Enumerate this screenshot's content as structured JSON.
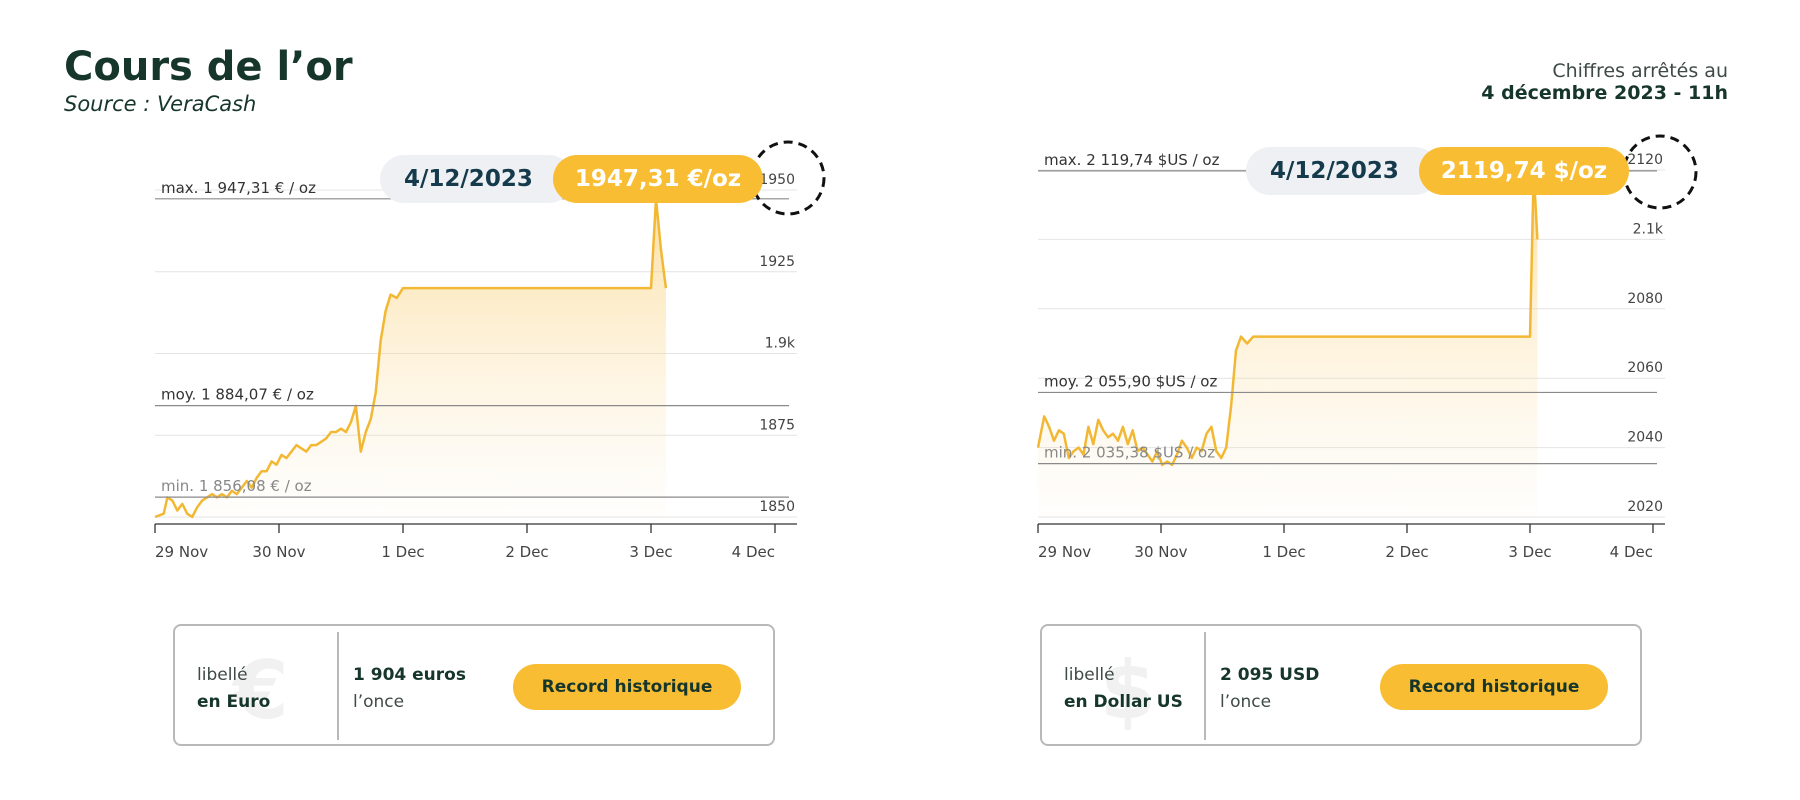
{
  "header": {
    "title": "Cours de l’or",
    "source": "Source : VeraCash",
    "asof_label": "Chiffres arrêtés au",
    "asof_date": "4 décembre 2023 - 11h"
  },
  "colors": {
    "gold": "#f8bd33",
    "line": "#f2b834",
    "dark": "#17362b",
    "navy": "#153a4c",
    "grey": "#b9b9b9"
  },
  "panels": [
    {
      "pill_date": "4/12/2023",
      "pill_value": "1947,31 €/oz",
      "card": {
        "currency_line1": "libellé",
        "currency_line2": "en Euro",
        "symbol": "€",
        "value_line1": "1 904 euros",
        "value_line2": "l’once",
        "button": "Record historique"
      }
    },
    {
      "pill_date": "4/12/2023",
      "pill_value": "2119,74 $/oz",
      "card": {
        "currency_line1": "libellé",
        "currency_line2": "en Dollar US",
        "symbol": "$",
        "value_line1": "2 095  USD",
        "value_line2": "l’once",
        "button": "Record historique"
      }
    }
  ],
  "chart_data": [
    {
      "type": "area",
      "unit": "€ / oz",
      "x_ticks": [
        "29 Nov",
        "30 Nov",
        "1 Dec",
        "2 Dec",
        "3 Dec",
        "4 Dec"
      ],
      "y_ticks": [
        "1850",
        "1875",
        "1.9k",
        "1925",
        "1950"
      ],
      "ylim": [
        1850,
        1950
      ],
      "reference_lines": [
        {
          "label": "max. 1 947,31 € / oz",
          "value": 1947.31
        },
        {
          "label": "moy. 1 884,07 € / oz",
          "value": 1884.07
        },
        {
          "label": "min. 1 856,08 € / oz",
          "value": 1856.08
        }
      ],
      "series": [
        {
          "x": [
            0,
            0.07,
            0.1,
            0.14,
            0.18,
            0.22,
            0.26,
            0.3,
            0.34,
            0.38,
            0.42,
            0.46,
            0.5,
            0.54,
            0.58,
            0.62,
            0.66,
            0.7,
            0.74,
            0.78,
            0.82,
            0.86,
            0.9,
            0.94,
            0.98,
            1.02,
            1.06,
            1.1,
            1.14,
            1.18,
            1.22,
            1.26,
            1.3,
            1.34,
            1.38,
            1.42,
            1.46,
            1.5,
            1.54,
            1.58,
            1.62,
            1.66,
            1.7,
            1.74,
            1.78,
            1.82,
            1.86,
            1.9,
            1.95,
            2.0,
            2.5,
            3.0,
            3.5,
            4.0,
            4.04,
            4.08,
            4.12
          ],
          "y": [
            1850,
            1851,
            1856,
            1855,
            1852,
            1854,
            1851,
            1850,
            1853,
            1855,
            1856,
            1857,
            1856,
            1857,
            1856,
            1858,
            1857,
            1859,
            1861,
            1859,
            1862,
            1864,
            1864,
            1867,
            1866,
            1869,
            1868,
            1870,
            1872,
            1871,
            1870,
            1872,
            1872,
            1873,
            1874,
            1876,
            1876,
            1877,
            1876,
            1879,
            1884,
            1870,
            1876,
            1880,
            1888,
            1904,
            1913,
            1918,
            1917,
            1920,
            1920,
            1920,
            1920,
            1920,
            1947.31,
            1932,
            1920
          ]
        }
      ]
    },
    {
      "type": "area",
      "unit": "$US / oz",
      "x_ticks": [
        "29 Nov",
        "30 Nov",
        "1 Dec",
        "2 Dec",
        "3 Dec",
        "4 Dec"
      ],
      "y_ticks": [
        "2020",
        "2040",
        "2060",
        "2080",
        "2.1k",
        "2120"
      ],
      "ylim": [
        2020,
        2120
      ],
      "reference_lines": [
        {
          "label": "max. 2 119,74 $US / oz",
          "value": 2119.74
        },
        {
          "label": "moy. 2 055,90 $US / oz",
          "value": 2055.9
        },
        {
          "label": "min. 2 035,38 $US / oz",
          "value": 2035.38
        }
      ],
      "series": [
        {
          "x": [
            0,
            0.05,
            0.09,
            0.13,
            0.17,
            0.21,
            0.25,
            0.29,
            0.33,
            0.37,
            0.41,
            0.45,
            0.49,
            0.53,
            0.57,
            0.61,
            0.65,
            0.69,
            0.73,
            0.77,
            0.81,
            0.85,
            0.89,
            0.93,
            0.97,
            1.01,
            1.05,
            1.09,
            1.13,
            1.17,
            1.21,
            1.25,
            1.29,
            1.33,
            1.37,
            1.41,
            1.45,
            1.49,
            1.53,
            1.57,
            1.61,
            1.65,
            1.7,
            1.75,
            1.8,
            1.85,
            1.9,
            2.5,
            3.0,
            3.5,
            4.0,
            4.03,
            4.06
          ],
          "y": [
            2040,
            2049,
            2046,
            2042,
            2045,
            2044,
            2037,
            2039,
            2040,
            2038,
            2046,
            2041,
            2048,
            2045,
            2043,
            2044,
            2042,
            2046,
            2041,
            2045,
            2039,
            2040,
            2038,
            2036,
            2039,
            2035,
            2036,
            2035,
            2038,
            2042,
            2040,
            2037,
            2040,
            2039,
            2044,
            2046,
            2039,
            2037,
            2040,
            2052,
            2068,
            2072,
            2070,
            2072,
            2072,
            2072,
            2072,
            2072,
            2072,
            2072,
            2072,
            2119.74,
            2100
          ]
        }
      ]
    }
  ]
}
